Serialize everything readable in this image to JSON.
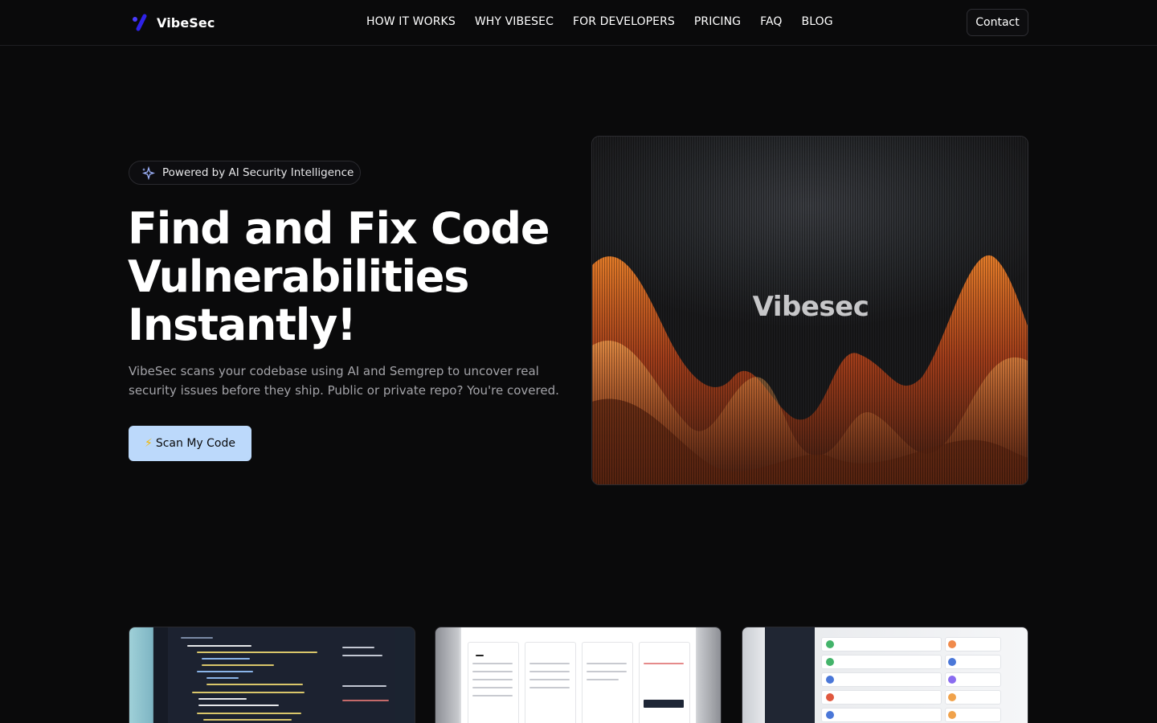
{
  "header": {
    "brand": "VibeSec",
    "nav": [
      "HOW IT WORKS",
      "WHY VIBESEC",
      "FOR DEVELOPERS",
      "PRICING",
      "FAQ",
      "BLOG"
    ],
    "contact_label": "Contact"
  },
  "hero": {
    "badge": "Powered by AI Security Intelligence",
    "title_lines": [
      "Find and Fix Code",
      "Vulnerabilities",
      "Instantly!"
    ],
    "subtitle": "VibeSec scans your codebase using AI and Semgrep to uncover real security issues before they ship. Public or private repo? You're covered.",
    "cta_label": "Scan My Code",
    "cta_icon": "lightning-icon",
    "visual_label": "Vibesec"
  },
  "previews": [
    {
      "name": "code-editor-preview"
    },
    {
      "name": "vulnerability-report-preview"
    },
    {
      "name": "repositories-preview"
    }
  ],
  "colors": {
    "background": "#0a0a0b",
    "cta": "#bcd9fb",
    "brand_accent": "#3b2bf5",
    "flame": "#e0611f"
  }
}
